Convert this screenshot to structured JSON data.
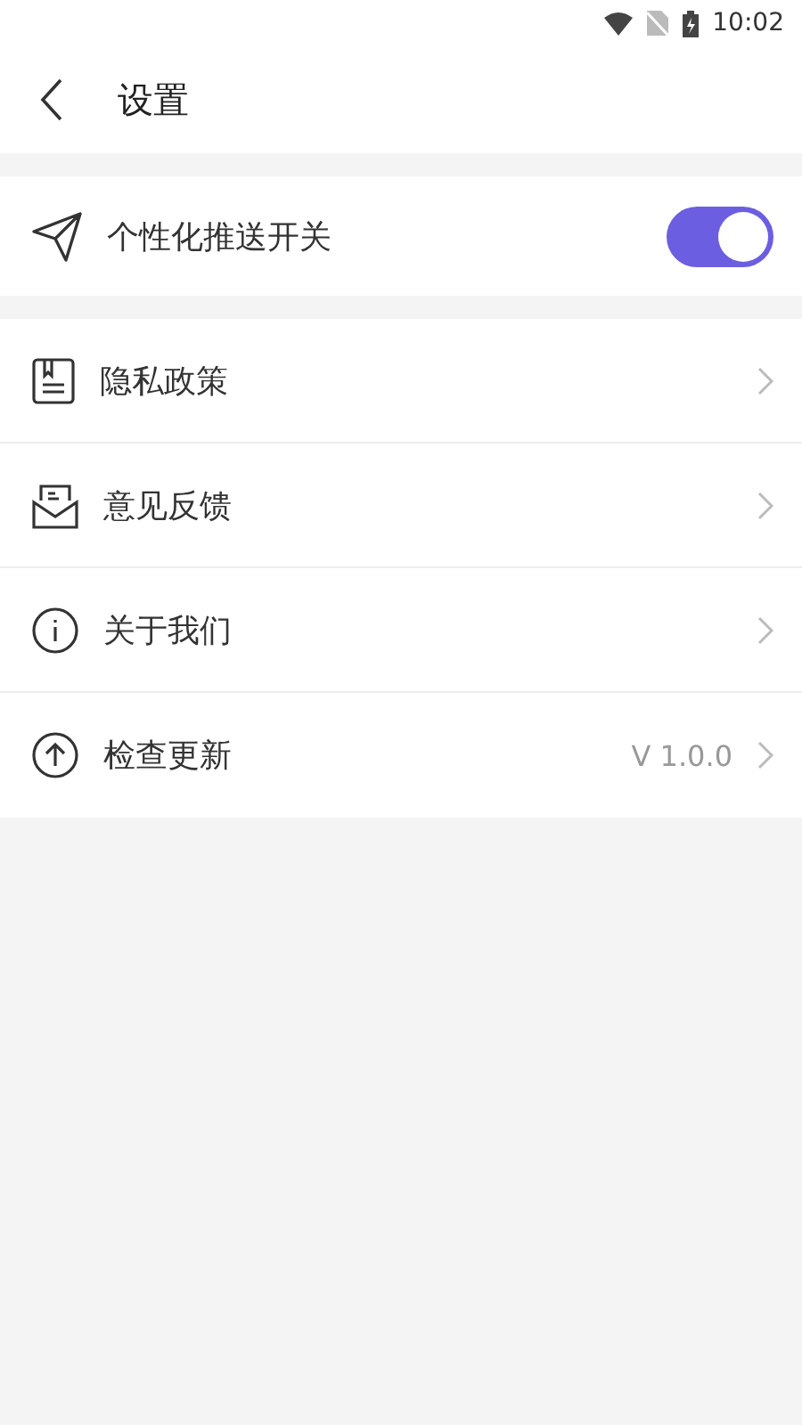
{
  "status_bar": {
    "time": "10:02"
  },
  "header": {
    "title": "设置"
  },
  "push_setting": {
    "label": "个性化推送开关",
    "on": true
  },
  "menu": [
    {
      "label": "隐私政策"
    },
    {
      "label": "意见反馈"
    },
    {
      "label": "关于我们"
    },
    {
      "label": "检查更新",
      "value": "V 1.0.0"
    }
  ]
}
